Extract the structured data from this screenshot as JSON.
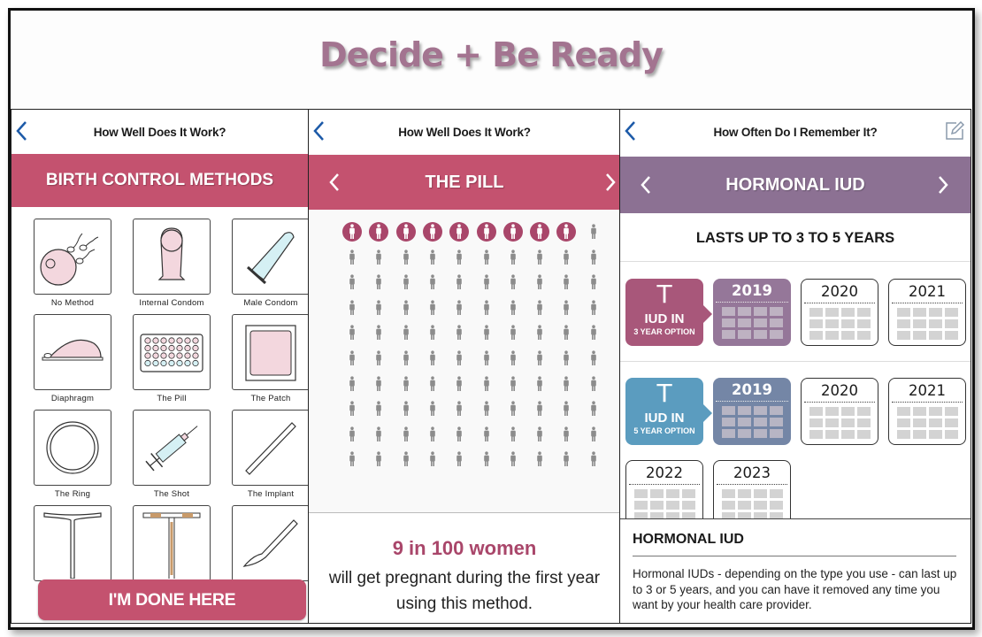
{
  "title": "Decide + Be Ready",
  "colors": {
    "title": "#a37490",
    "pink": "#c4526f",
    "pink_dark": "#a9466a",
    "purple": "#8c7193",
    "callout_3yr": "#a8577a",
    "cal_3yr_2019": "#957799",
    "callout_5yr": "#5b9cbf",
    "cal_5yr_2019": "#7486a6",
    "back_arrow": "#1c5aa8"
  },
  "panel_methods": {
    "nav_title": "How Well Does It Work?",
    "back_icon": "chevron-left-icon",
    "banner": "BIRTH CONTROL METHODS",
    "methods": [
      {
        "label": "No Method",
        "icon": "egg-sperm-icon"
      },
      {
        "label": "Internal Condom",
        "icon": "internal-condom-icon"
      },
      {
        "label": "Male Condom",
        "icon": "male-condom-icon"
      },
      {
        "label": "Diaphragm",
        "icon": "diaphragm-icon"
      },
      {
        "label": "The Pill",
        "icon": "pill-pack-icon"
      },
      {
        "label": "The Patch",
        "icon": "patch-icon"
      },
      {
        "label": "The Ring",
        "icon": "ring-icon"
      },
      {
        "label": "The Shot",
        "icon": "syringe-icon"
      },
      {
        "label": "The Implant",
        "icon": "implant-rod-icon"
      },
      {
        "label": "",
        "icon": "copper-iud-icon"
      },
      {
        "label": "",
        "icon": "hormonal-iud-icon"
      },
      {
        "label": "",
        "icon": "scalpel-icon"
      }
    ],
    "done_button": "I'M DONE HERE"
  },
  "panel_pill": {
    "nav_title": "How Well Does It Work?",
    "banner": "THE PILL",
    "grid": {
      "columns": 10,
      "rows": 10,
      "total": 100,
      "highlighted": 9
    },
    "stat": "9 in 100 women",
    "stat_desc_line1": "will get pregnant during the first year",
    "stat_desc_line2": "using this method."
  },
  "panel_iud": {
    "nav_title": "How Often Do I Remember It?",
    "edit_icon": "edit-note-icon",
    "banner": "HORMONAL IUD",
    "lasts": "LASTS UP TO 3 TO 5 YEARS",
    "options": [
      {
        "callout_glyph": "T",
        "callout_title": "IUD IN",
        "callout_option": "3 YEAR OPTION",
        "years": [
          "2019",
          "2020",
          "2021"
        ]
      },
      {
        "callout_glyph": "T",
        "callout_title": "IUD IN",
        "callout_option": "5 YEAR OPTION",
        "years": [
          "2019",
          "2020",
          "2021",
          "2022",
          "2023"
        ]
      }
    ],
    "info_title": "HORMONAL IUD",
    "info_text": "Hormonal IUDs - depending on the type you use - can last up to 3 or 5 years, and you can have it removed any time you want by your health care provider."
  }
}
